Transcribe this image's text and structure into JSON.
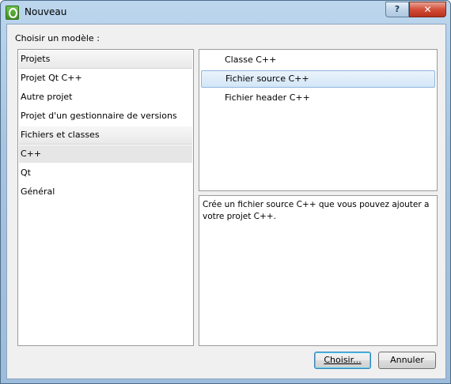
{
  "window": {
    "title": "Nouveau",
    "help_label": "?",
    "close_label": "✕"
  },
  "choose_label": "Choisir un modèle :",
  "left": {
    "groups": [
      {
        "header": "Projets",
        "items": [
          "Projet Qt C++",
          "Autre projet",
          "Projet d'un gestionnaire de versions"
        ]
      },
      {
        "header": "Fichiers et classes",
        "items": [
          "C++",
          "Qt",
          "Général"
        ]
      }
    ],
    "selected": "C++"
  },
  "templates": {
    "items": [
      "Classe C++",
      "Fichier source C++",
      "Fichier header C++"
    ],
    "selected": "Fichier source C++"
  },
  "description": "Crée un fichier source C++ que vous pouvez ajouter a votre projet C++.",
  "buttons": {
    "choose": "Choisir...",
    "cancel": "Annuler"
  }
}
